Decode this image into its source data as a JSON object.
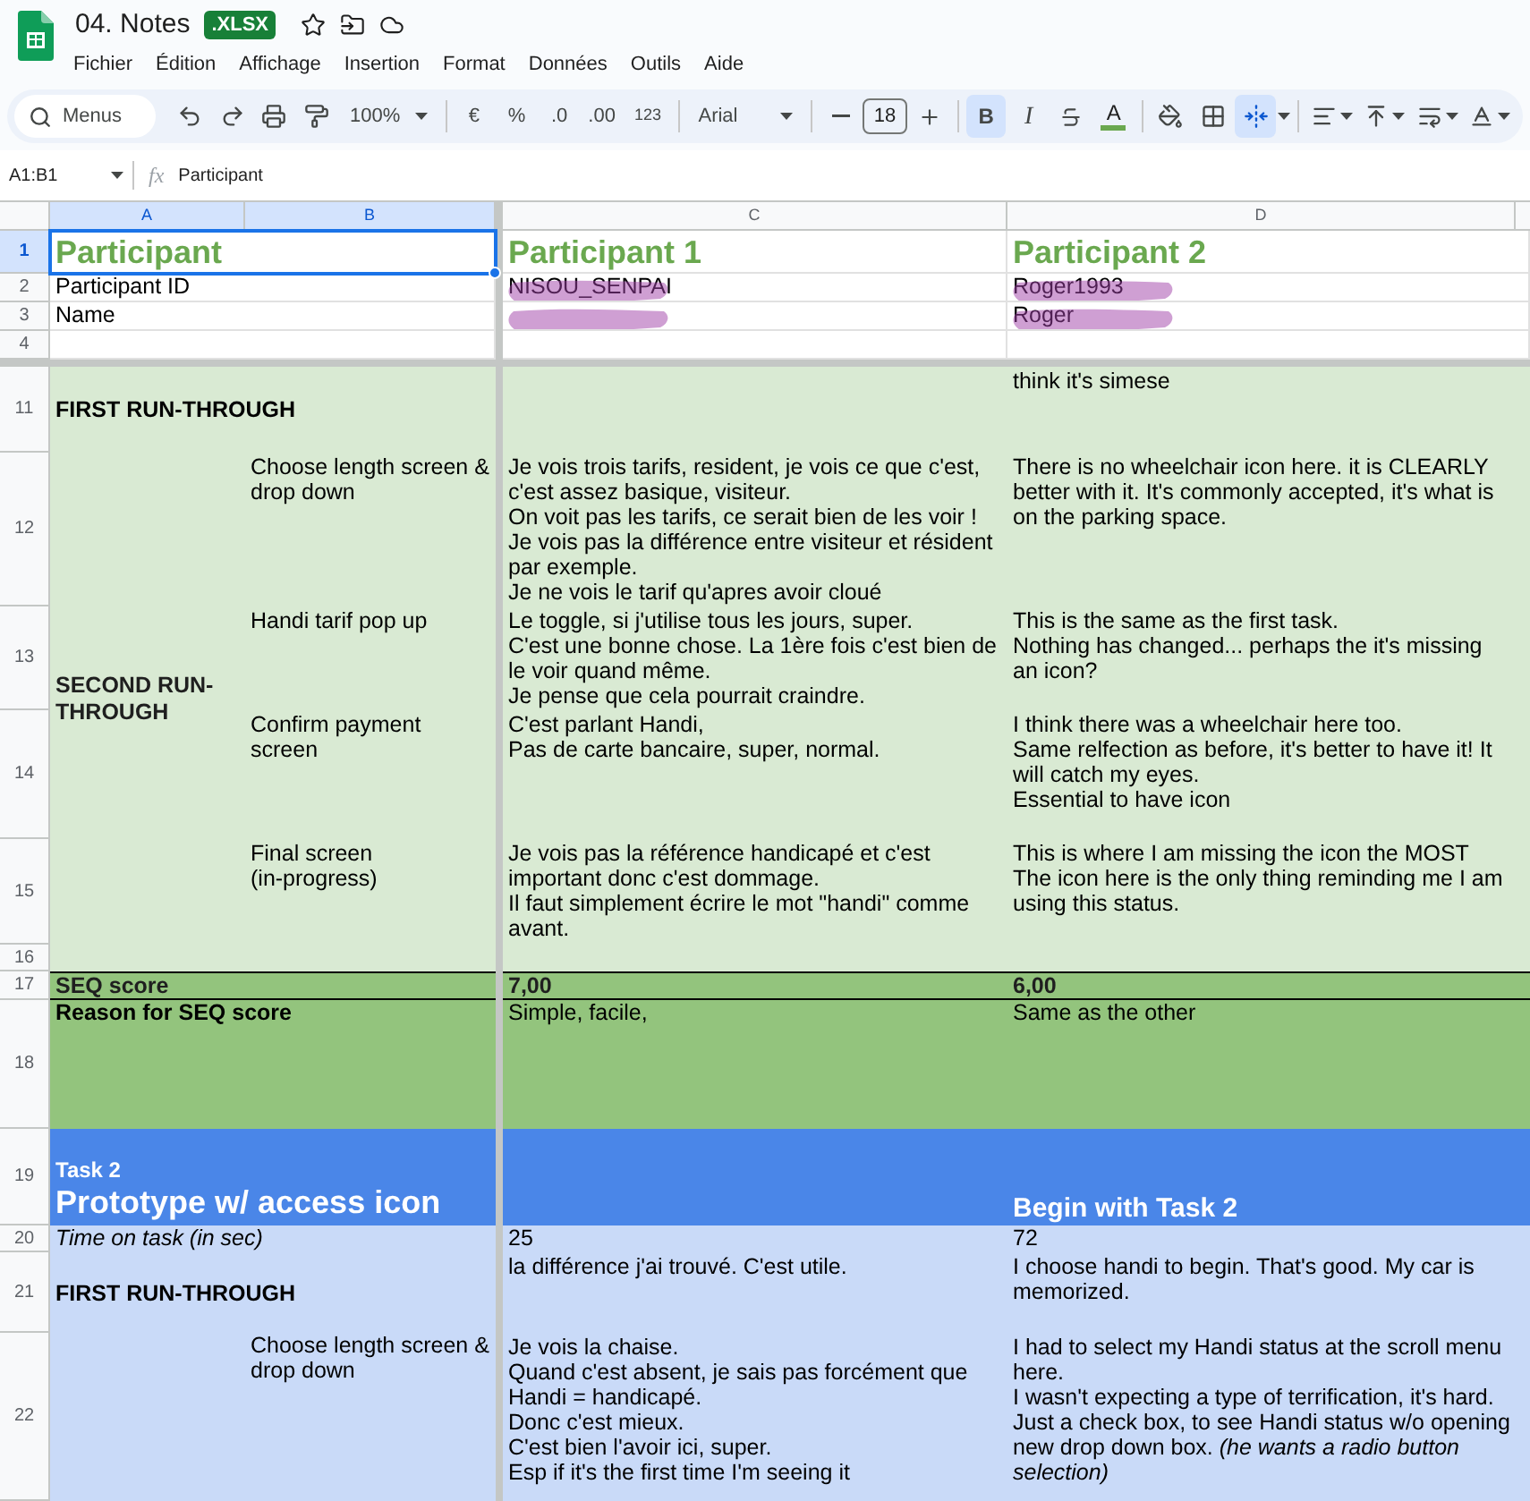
{
  "header": {
    "title": "04. Notes",
    "badge": ".XLSX",
    "menu": [
      "Fichier",
      "Édition",
      "Affichage",
      "Insertion",
      "Format",
      "Données",
      "Outils",
      "Aide"
    ]
  },
  "toolbar": {
    "search_placeholder": "Menus",
    "zoom": "100%",
    "currency": "€",
    "percent": "%",
    "decimal_decrease": ".0",
    "decimal_increase": ".00",
    "number_format": "123",
    "font": "Arial",
    "font_size": "18",
    "bold": {
      "label": "B",
      "selected": true
    },
    "italic": {
      "label": "I",
      "selected": false
    },
    "text_color": {
      "label": "A"
    },
    "merge": {
      "selected": true
    }
  },
  "formula_bar": {
    "range": "A1:B1",
    "fx": "fx",
    "value": "Participant"
  },
  "sheet": {
    "columns": [
      {
        "label": "A",
        "selected": true
      },
      {
        "label": "B",
        "selected": true
      },
      {
        "label": "C",
        "selected": false
      },
      {
        "label": "D",
        "selected": false
      }
    ],
    "frozen_rows": [
      {
        "number": "1",
        "kind": "title",
        "selected": true,
        "a": "Participant",
        "c": "Participant 1",
        "d": "Participant 2"
      },
      {
        "number": "2",
        "kind": "plain",
        "selected": false,
        "redacted": true,
        "a": "Participant ID",
        "c": "NISOU_SENPAI",
        "d": "Roger1993"
      },
      {
        "number": "3",
        "kind": "plain",
        "selected": false,
        "redacted": true,
        "a": "Name",
        "d": "Roger"
      },
      {
        "number": "4",
        "kind": "plain",
        "selected": false
      }
    ],
    "rows": [
      {
        "number": "11",
        "kind": "section",
        "color": "#d9ead3",
        "a": "FIRST RUN-THROUGH",
        "d": "think it's simese"
      },
      {
        "kind": "group",
        "label": "SECOND RUN-THROUGH",
        "color": "#d9ead3",
        "rows": [
          {
            "number": "12",
            "b": "Choose length screen & drop down",
            "c": "Je vois trois tarifs, resident, je vois ce que c'est, c'est assez basique, visiteur.\nOn voit pas les tarifs, ce serait bien de les voir ! Je vois pas la différence entre visiteur et résident par exemple.\nJe ne vois le tarif qu'apres avoir cloué",
            "d": "There is no wheelchair icon here. it is CLEARLY better with it. It's commonly accepted, it's what is on the parking space."
          },
          {
            "number": "13",
            "b": "Handi tarif pop up",
            "c": "Le toggle, si j'utilise tous les jours, super.\nC'est une bonne chose. La 1ère fois c'est bien de le voir quand même.\nJe pense que cela pourrait craindre.",
            "d": "This is the same as the first task.\nNothing has changed... perhaps the it's missing an icon?"
          },
          {
            "number": "14",
            "b": "Confirm payment screen",
            "c": "C'est parlant Handi,\nPas de carte bancaire, super, normal.",
            "d": "I think there was a wheelchair here too.\nSame relfection as before, it's better to have it! It will catch my eyes.\nEssential to have icon"
          },
          {
            "number": "15",
            "b": "Final screen\n(in-progress)",
            "c": "Je vois pas la référence handicapé et c'est important donc c'est dommage.\nIl faut simplement écrire le mot \"handi\" comme avant.",
            "d": "This is where I am missing the icon the MOST\nThe icon here is the only thing reminding me I am using this status."
          }
        ]
      },
      {
        "number": "16",
        "kind": "plain",
        "color": "#d9ead3"
      },
      {
        "number": "17",
        "kind": "score",
        "color": "#93c47d",
        "a": "SEQ score",
        "c": "7,00",
        "d": "6,00"
      },
      {
        "number": "18",
        "kind": "label",
        "color": "#93c47d",
        "a": "Reason for SEQ score",
        "c": "Simple, facile,",
        "d": "Same as the other"
      },
      {
        "number": "19",
        "kind": "task",
        "color": "#4a86e8",
        "caption": "Task 2",
        "a": "Prototype w/ access icon",
        "d": "Begin with Task 2"
      },
      {
        "number": "20",
        "kind": "italic",
        "color": "#c9daf8",
        "a": "Time on task (in sec)",
        "c": "25",
        "d": "72"
      },
      {
        "number": "21",
        "kind": "section",
        "color": "#c9daf8",
        "a": "FIRST RUN-THROUGH",
        "c": "la différence j'ai trouvé. C'est utile.",
        "d": "I choose handi to begin. That's good. My car is memorized."
      },
      {
        "number": "22",
        "kind": "plain",
        "color": "#c9daf8",
        "b": "Choose length screen & drop down",
        "c": "Je vois la chaise.\nQuand c'est absent, je sais pas forcément que Handi = handicapé.\nDonc c'est mieux.\nC'est bien l'avoir ici, super.\nEsp if it's the first time I'm seeing it",
        "d": "I had to select my Handi status at the scroll menu here.\nI wasn't expecting a type of terrification, it's hard.\nJust a check box, to see Handi status w/o opening new drop down box. *(he wants a radio button selection)*"
      }
    ]
  }
}
